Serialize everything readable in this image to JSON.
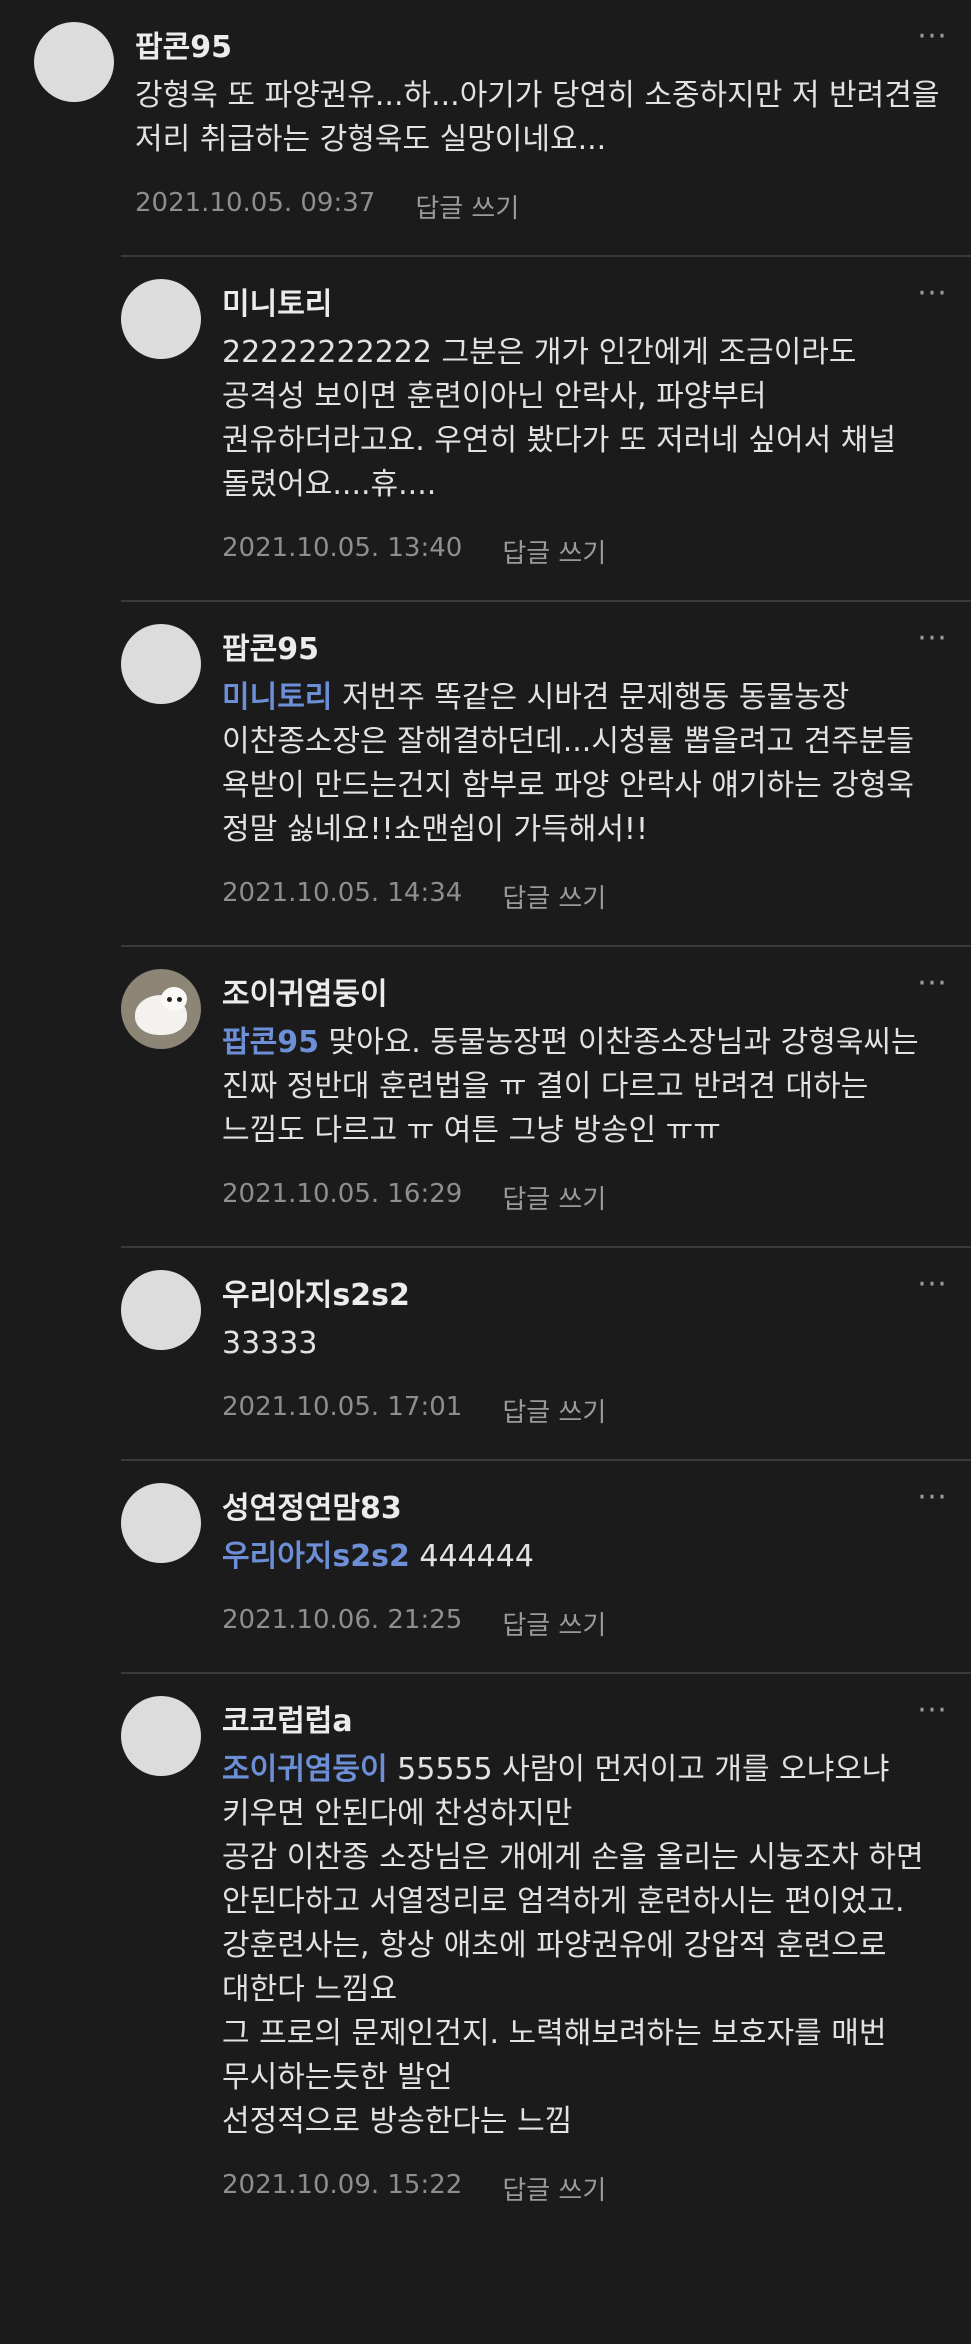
{
  "reply_label": "답글 쓰기",
  "more_icon": "⋯",
  "comments": [
    {
      "author": "팝콘95",
      "mention": "",
      "text": "강형욱 또 파양권유...하...아기가 당연히 소중하지만 저 반려견을 저리 취급하는 강형욱도 실망이네요...",
      "date": "2021.10.05. 09:37",
      "reply": false,
      "avatar": "default"
    },
    {
      "author": "미니토리",
      "mention": "",
      "text": "22222222222 그분은 개가 인간에게 조금이라도 공격성 보이면 훈련이아닌 안락사, 파양부터 권유하더라고요. 우연히 봤다가 또 저러네 싶어서 채널 돌렸어요....휴....",
      "date": "2021.10.05. 13:40",
      "reply": true,
      "avatar": "default"
    },
    {
      "author": "팝콘95",
      "mention": "미니토리",
      "text": " 저번주 똑같은 시바견 문제행동 동물농장 이찬종소장은 잘해결하던데...시청률 뽑을려고 견주분들 욕받이 만드는건지 함부로 파양 안락사 얘기하는 강형욱 정말 싫네요!!쇼맨쉽이 가득해서!!",
      "date": "2021.10.05. 14:34",
      "reply": true,
      "avatar": "default"
    },
    {
      "author": "조이귀염둥이",
      "mention": "팝콘95",
      "text": " 맞아요. 동물농장편 이찬종소장님과 강형욱씨는 진짜 정반대 훈련법을 ㅠ 결이 다르고 반려견 대하는 느낌도 다르고 ㅠ 여튼 그냥 방송인 ㅠㅠ",
      "date": "2021.10.05. 16:29",
      "reply": true,
      "avatar": "photo"
    },
    {
      "author": "우리아지s2s2",
      "mention": "",
      "text": "33333",
      "date": "2021.10.05. 17:01",
      "reply": true,
      "avatar": "default"
    },
    {
      "author": "성연정연맘83",
      "mention": "우리아지s2s2",
      "text": " 444444",
      "date": "2021.10.06. 21:25",
      "reply": true,
      "avatar": "default"
    },
    {
      "author": "코코럽럽a",
      "mention": "조이귀염둥이",
      "text": " 55555 사람이 먼저이고 개를 오냐오냐 키우면 안된다에 찬성하지만\n공감 이찬종 소장님은 개에게 손을 올리는 시늉조차 하면\n안된다하고 서열정리로 엄격하게 훈련하시는 편이었고.\n강훈련사는, 항상 애초에 파양권유에 강압적 훈련으로 대한다 느낌요\n그 프로의 문제인건지. 노력해보려하는 보호자를 매번 무시하는듯한 발언\n선정적으로 방송한다는 느낌",
      "date": "2021.10.09. 15:22",
      "reply": true,
      "avatar": "default"
    }
  ]
}
